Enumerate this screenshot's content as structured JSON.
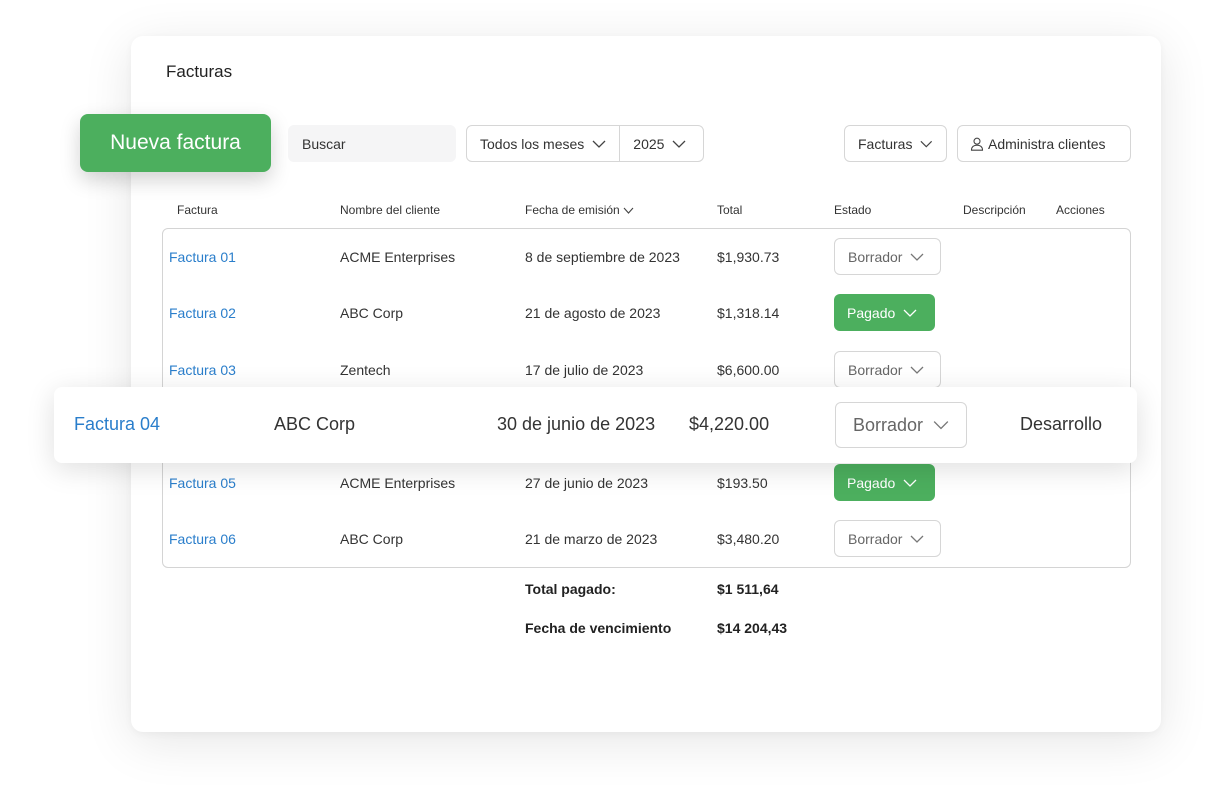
{
  "header": {
    "title": "Facturas"
  },
  "toolbar": {
    "new_invoice": "Nueva factura",
    "search_placeholder": "Buscar",
    "month_filter": "Todos los meses",
    "year_filter": "2025",
    "type_filter": "Facturas",
    "manage_clients": "Administra clientes"
  },
  "table": {
    "columns": [
      "Factura",
      "Nombre del cliente",
      "Fecha de emisión",
      "Total",
      "Estado",
      "Descripción",
      "Acciones"
    ],
    "rows": [
      {
        "id": "Factura 01",
        "client": "ACME Enterprises",
        "date": "8 de septiembre de 2023",
        "total": "$1,930.73",
        "status": "Borrador",
        "description": ""
      },
      {
        "id": "Factura 02",
        "client": "ABC Corp",
        "date": "21 de agosto de 2023",
        "total": "$1,318.14",
        "status": "Pagado",
        "description": ""
      },
      {
        "id": "Factura 03",
        "client": "Zentech",
        "date": "17 de julio de 2023",
        "total": "$6,600.00",
        "status": "Borrador",
        "description": ""
      },
      {
        "id": "Factura 04",
        "client": "ABC Corp",
        "date": "30 de junio de 2023",
        "total": "$4,220.00",
        "status": "Borrador",
        "description": "Desarrollo"
      },
      {
        "id": "Factura 05",
        "client": "ACME Enterprises",
        "date": "27 de junio de 2023",
        "total": "$193.50",
        "status": "Pagado",
        "description": ""
      },
      {
        "id": "Factura 06",
        "client": "ABC Corp",
        "date": "21 de marzo de 2023",
        "total": "$3,480.20",
        "status": "Borrador",
        "description": ""
      }
    ]
  },
  "summary": {
    "paid_label": "Total pagado:",
    "paid_value": "$1 511,64",
    "due_label": "Fecha de vencimiento",
    "due_value": "$14 204,43"
  },
  "colors": {
    "accent": "#4caf5e",
    "link": "#2a7ecb"
  }
}
